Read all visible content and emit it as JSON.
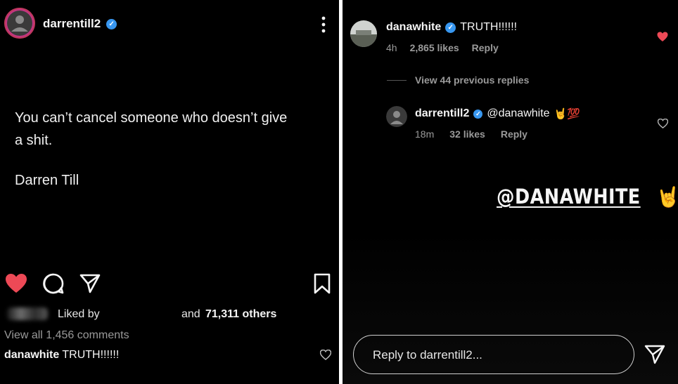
{
  "left_post": {
    "username": "darrentill2",
    "caption_lines": [
      "You can’t cancel someone who doesn’t give",
      "a shit."
    ],
    "caption_author": "Darren Till",
    "liked_by_prefix": "Liked by",
    "liked_by_suffix_and": "and",
    "liked_by_others": "71,311 others",
    "view_comments": "View all 1,456 comments",
    "top_comment_user": "danawhite",
    "top_comment_text": "TRUTH!!!!!!"
  },
  "right_thread": {
    "comment": {
      "username": "danawhite",
      "text": "TRUTH!!!!!!",
      "time": "4h",
      "likes": "2,865 likes",
      "reply_label": "Reply"
    },
    "view_previous": "View 44 previous replies",
    "reply": {
      "username": "darrentill2",
      "mention": "@danawhite",
      "emoji": "🤘💯",
      "time": "18m",
      "likes": "32 likes",
      "reply_label": "Reply"
    },
    "sticker_text": "@DANAWHITE",
    "sticker_emoji": "🤘",
    "reply_placeholder": "Reply to darrentill2..."
  },
  "colors": {
    "like_red": "#ed4956",
    "verified_blue": "#3897f0"
  },
  "icons": [
    "heart-icon",
    "comment-icon",
    "share-icon",
    "bookmark-icon",
    "more-icon",
    "send-icon"
  ]
}
